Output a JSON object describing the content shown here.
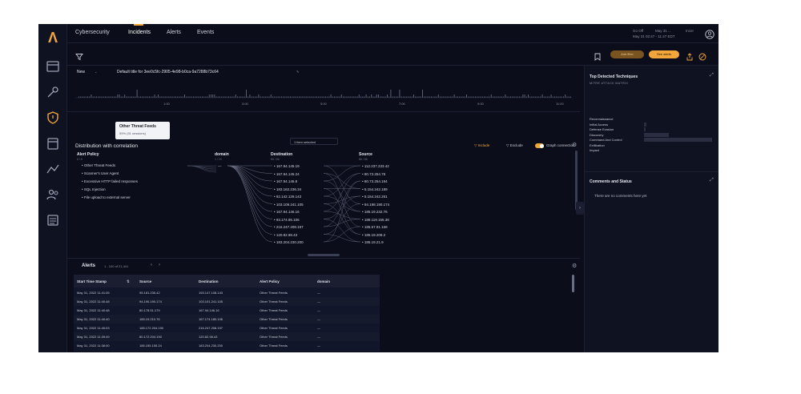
{
  "nav": {
    "items": [
      "Cybersecurity",
      "Incidents",
      "Alerts",
      "Events"
    ],
    "active": "Incidents",
    "top_right": [
      "Go Off",
      "May 31 ...",
      "Incer"
    ],
    "timestamp": "May 31 02:47 - 11:47 EDT"
  },
  "toolbar": {
    "btn1": "Add filter",
    "btn2": "See alerts"
  },
  "title": {
    "view": "New",
    "text": "Default title for 3ee0c5fc-2905-4e98-b0ca-9a7288b73c64"
  },
  "timeline": {
    "ticks": [
      "1:00",
      "3:00",
      "5:00",
      "7:00",
      "9:00",
      "11:00",
      "1:00"
    ]
  },
  "tooltip": {
    "title": "Other Threat Feeds",
    "value": "59% (91 sessions)"
  },
  "distribution": {
    "title": "Distribution with correlation",
    "selected": "1 item selected",
    "include": "Include",
    "exclude": "Exclude",
    "graph_connection": "Graph connection",
    "columns": [
      {
        "head": "Alert Policy",
        "sub": "6 / 6",
        "items": [
          "Other Threat Feeds",
          "Scanner's User Agent",
          "Excessive HTTP failed responses",
          "SQL Injection",
          "File upload to external server"
        ]
      },
      {
        "head": "domain",
        "sub": "1 / 10",
        "items": [
          "—"
        ]
      },
      {
        "head": "Destination",
        "sub": "86 / 86",
        "items": [
          "167.94.145.19",
          "167.94.145.24",
          "167.94.145.8",
          "183.162.236.34",
          "92.142.129.143",
          "103.109.241.105",
          "167.94.146.16",
          "93.174.95.106",
          "216.247.208.197",
          "120.82.98.43",
          "183.204.230.200"
        ]
      },
      {
        "head": "Source",
        "sub": "86 / 86",
        "items": [
          "112.237.233.42",
          "80.73.254.78",
          "80.73.254.194",
          "5.154.242.189",
          "5.154.242.251",
          "94.198.190.174",
          "185.19.232.76",
          "188.119.155.38",
          "185.57.91.158",
          "185.19.209.2",
          "185.19.21.9"
        ]
      }
    ]
  },
  "alerts": {
    "title": "Alerts",
    "range": "1 - 100 of 21,441",
    "columns": [
      "Start Time Stamp",
      "Source",
      "Destination",
      "Alert Policy",
      "domain"
    ],
    "rows": [
      [
        "May 31, 2022 11:41:05",
        "95.181.235.42",
        "193.147.108.143",
        "Other Threat Feeds",
        "—"
      ],
      [
        "May 31, 2022 11:40:48",
        "94.190.190.174",
        "103.101.241.105",
        "Other Threat Feeds",
        "—"
      ],
      [
        "May 31, 2022 11:40:48",
        "80.178.51.179",
        "167.94.146.16",
        "Other Threat Feeds",
        "—"
      ],
      [
        "May 31, 2022 11:40:40",
        "185.19.210.76",
        "167.174.180.106",
        "Other Threat Feeds",
        "—"
      ],
      [
        "May 31, 2022 11:40:03",
        "185.172.204.190",
        "216.247.208.197",
        "Other Threat Feeds",
        "—"
      ],
      [
        "May 31, 2022 11:39:49",
        "80.172.204.190",
        "120.82.98.43",
        "Other Threat Feeds",
        "—"
      ],
      [
        "May 31, 2022 11:38:00",
        "185.155.155.24",
        "183.204.230.200",
        "Other Threat Feeds",
        "—"
      ]
    ]
  },
  "right_panel": {
    "techniques_title": "Top Detected Techniques",
    "techniques_sub": "MITRE ATT&CK MATRIX",
    "techniques": [
      {
        "name": "Reconnaissance",
        "value": 0
      },
      {
        "name": "Initial Access",
        "value": 4
      },
      {
        "name": "Defense Evasion",
        "value": 1
      },
      {
        "name": "Discovery",
        "value": 36
      },
      {
        "name": "Command And Control",
        "value": 100
      },
      {
        "name": "Exfiltration",
        "value": 0
      },
      {
        "name": "Impact",
        "value": 0
      }
    ],
    "comments_title": "Comments and Status",
    "comments_empty": "There are no comments here yet"
  },
  "colors": {
    "accent": "#f2a53a",
    "bg": "#0b0e1a",
    "panel": "#0f1220"
  }
}
